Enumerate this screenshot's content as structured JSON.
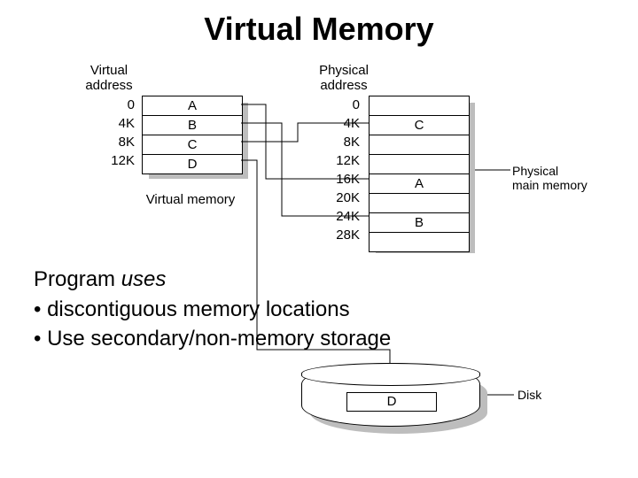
{
  "title": "Virtual Memory",
  "virtual": {
    "header": "Virtual\naddress",
    "caption": "Virtual memory",
    "addresses": [
      "0",
      "4K",
      "8K",
      "12K"
    ],
    "cells": [
      "A",
      "B",
      "C",
      "D"
    ]
  },
  "physical": {
    "header": "Physical\naddress",
    "label": "Physical\nmain memory",
    "addresses": [
      "0",
      "4K",
      "8K",
      "12K",
      "16K",
      "20K",
      "24K",
      "28K"
    ],
    "cells": [
      "",
      "C",
      "",
      "",
      "A",
      "",
      "B",
      ""
    ]
  },
  "disk": {
    "label": "Disk",
    "cell": "D"
  },
  "text": {
    "lead_plain": "Program ",
    "lead_italic": "uses",
    "bullet1": "discontiguous memory locations",
    "bullet2": "Use secondary/non-memory storage"
  }
}
